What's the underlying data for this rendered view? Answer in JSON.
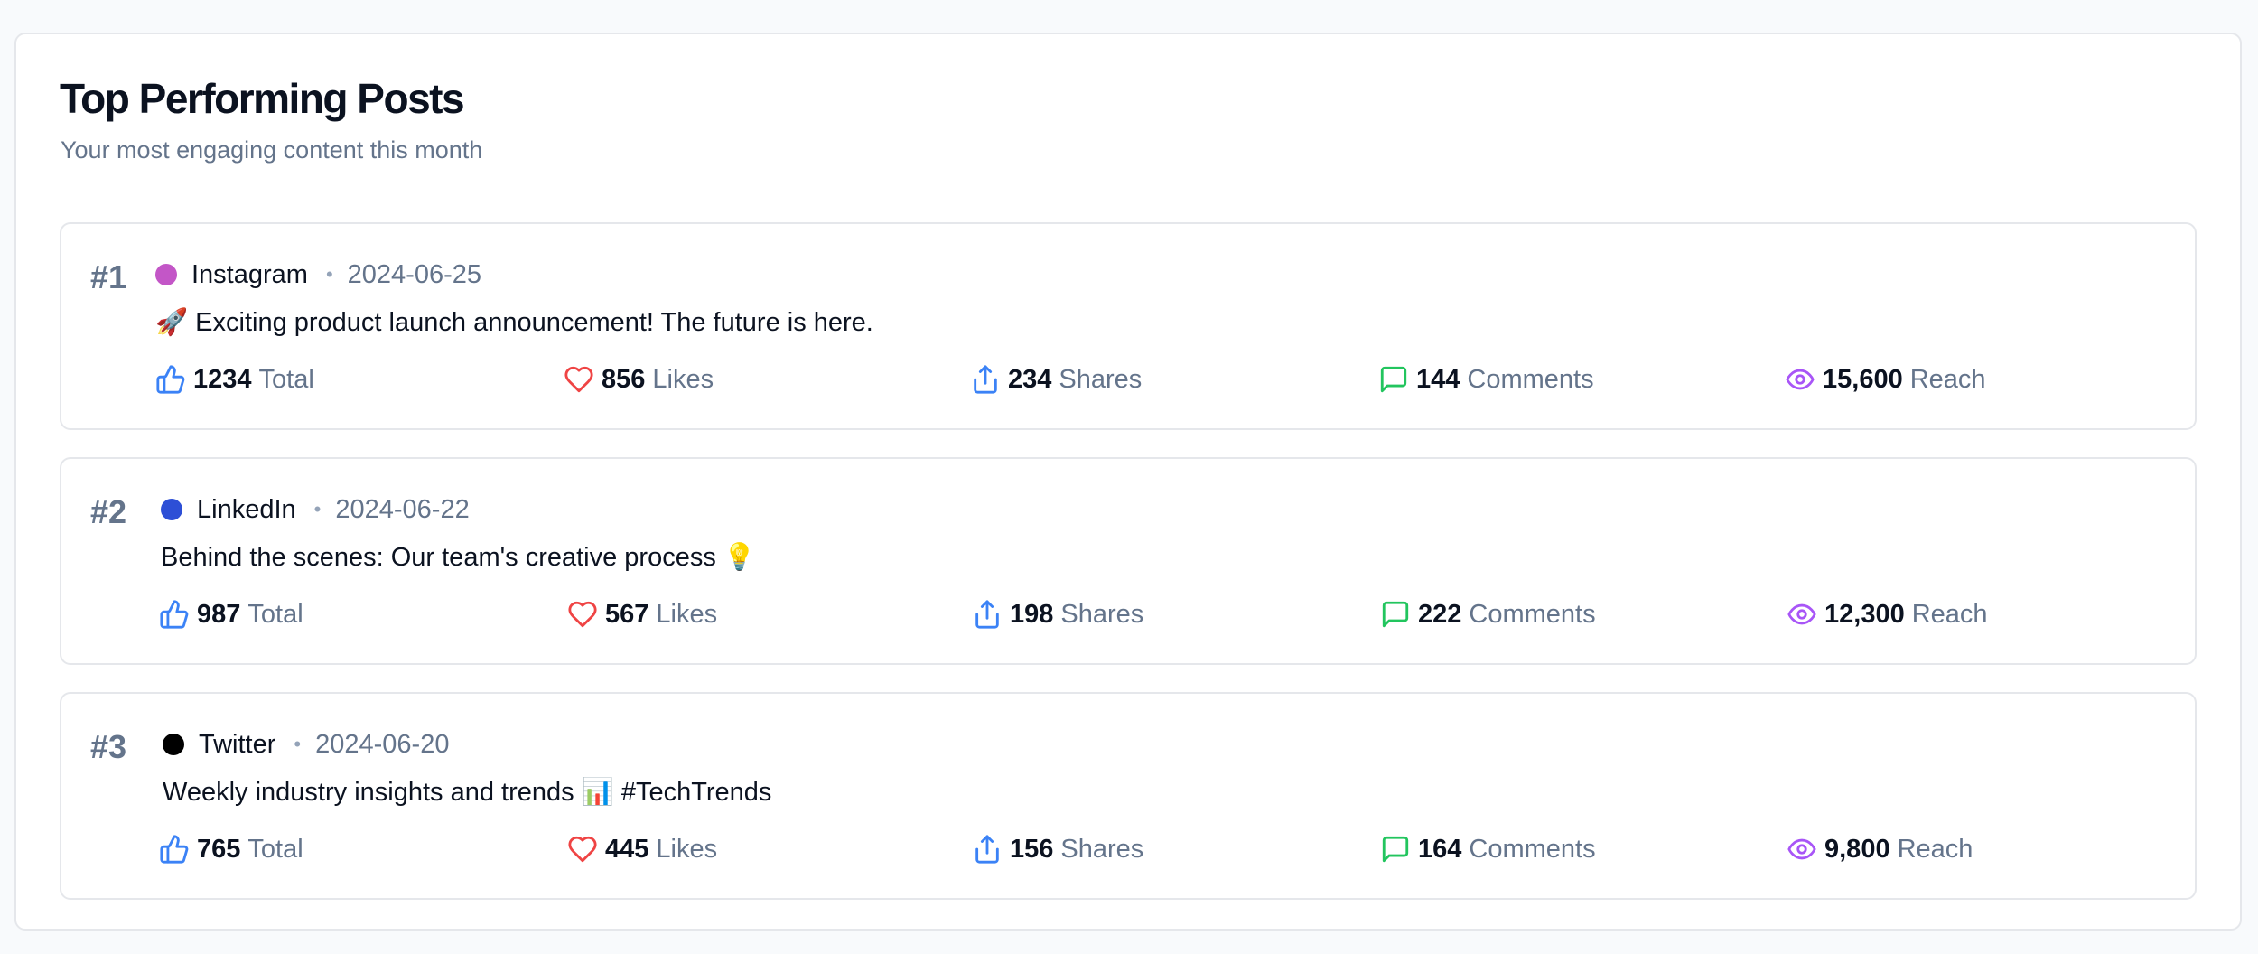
{
  "card": {
    "title": "Top Performing Posts",
    "subtitle": "Your most engaging content this month"
  },
  "colors": {
    "total_icon": "#3b82f6",
    "likes_icon": "#ef4444",
    "shares_icon": "#3b82f6",
    "comments_icon": "#22c55e",
    "reach_icon": "#a855f7"
  },
  "posts": [
    {
      "rank": "#1",
      "platform": "Instagram",
      "platform_color": "#c356c7",
      "separator": "•",
      "date": "2024-06-25",
      "content": "🚀 Exciting product launch announcement! The future is here.",
      "total": "1234",
      "total_label": "Total",
      "likes": "856",
      "likes_label": "Likes",
      "shares": "234",
      "shares_label": "Shares",
      "comments": "144",
      "comments_label": "Comments",
      "reach": "15,600",
      "reach_label": "Reach"
    },
    {
      "rank": "#2",
      "platform": "LinkedIn",
      "platform_color": "#2d4fd6",
      "separator": "•",
      "date": "2024-06-22",
      "content": "Behind the scenes: Our team's creative process 💡",
      "total": "987",
      "total_label": "Total",
      "likes": "567",
      "likes_label": "Likes",
      "shares": "198",
      "shares_label": "Shares",
      "comments": "222",
      "comments_label": "Comments",
      "reach": "12,300",
      "reach_label": "Reach"
    },
    {
      "rank": "#3",
      "platform": "Twitter",
      "platform_color": "#000000",
      "separator": "•",
      "date": "2024-06-20",
      "content": "Weekly industry insights and trends 📊 #TechTrends",
      "total": "765",
      "total_label": "Total",
      "likes": "445",
      "likes_label": "Likes",
      "shares": "156",
      "shares_label": "Shares",
      "comments": "164",
      "comments_label": "Comments",
      "reach": "9,800",
      "reach_label": "Reach"
    }
  ]
}
